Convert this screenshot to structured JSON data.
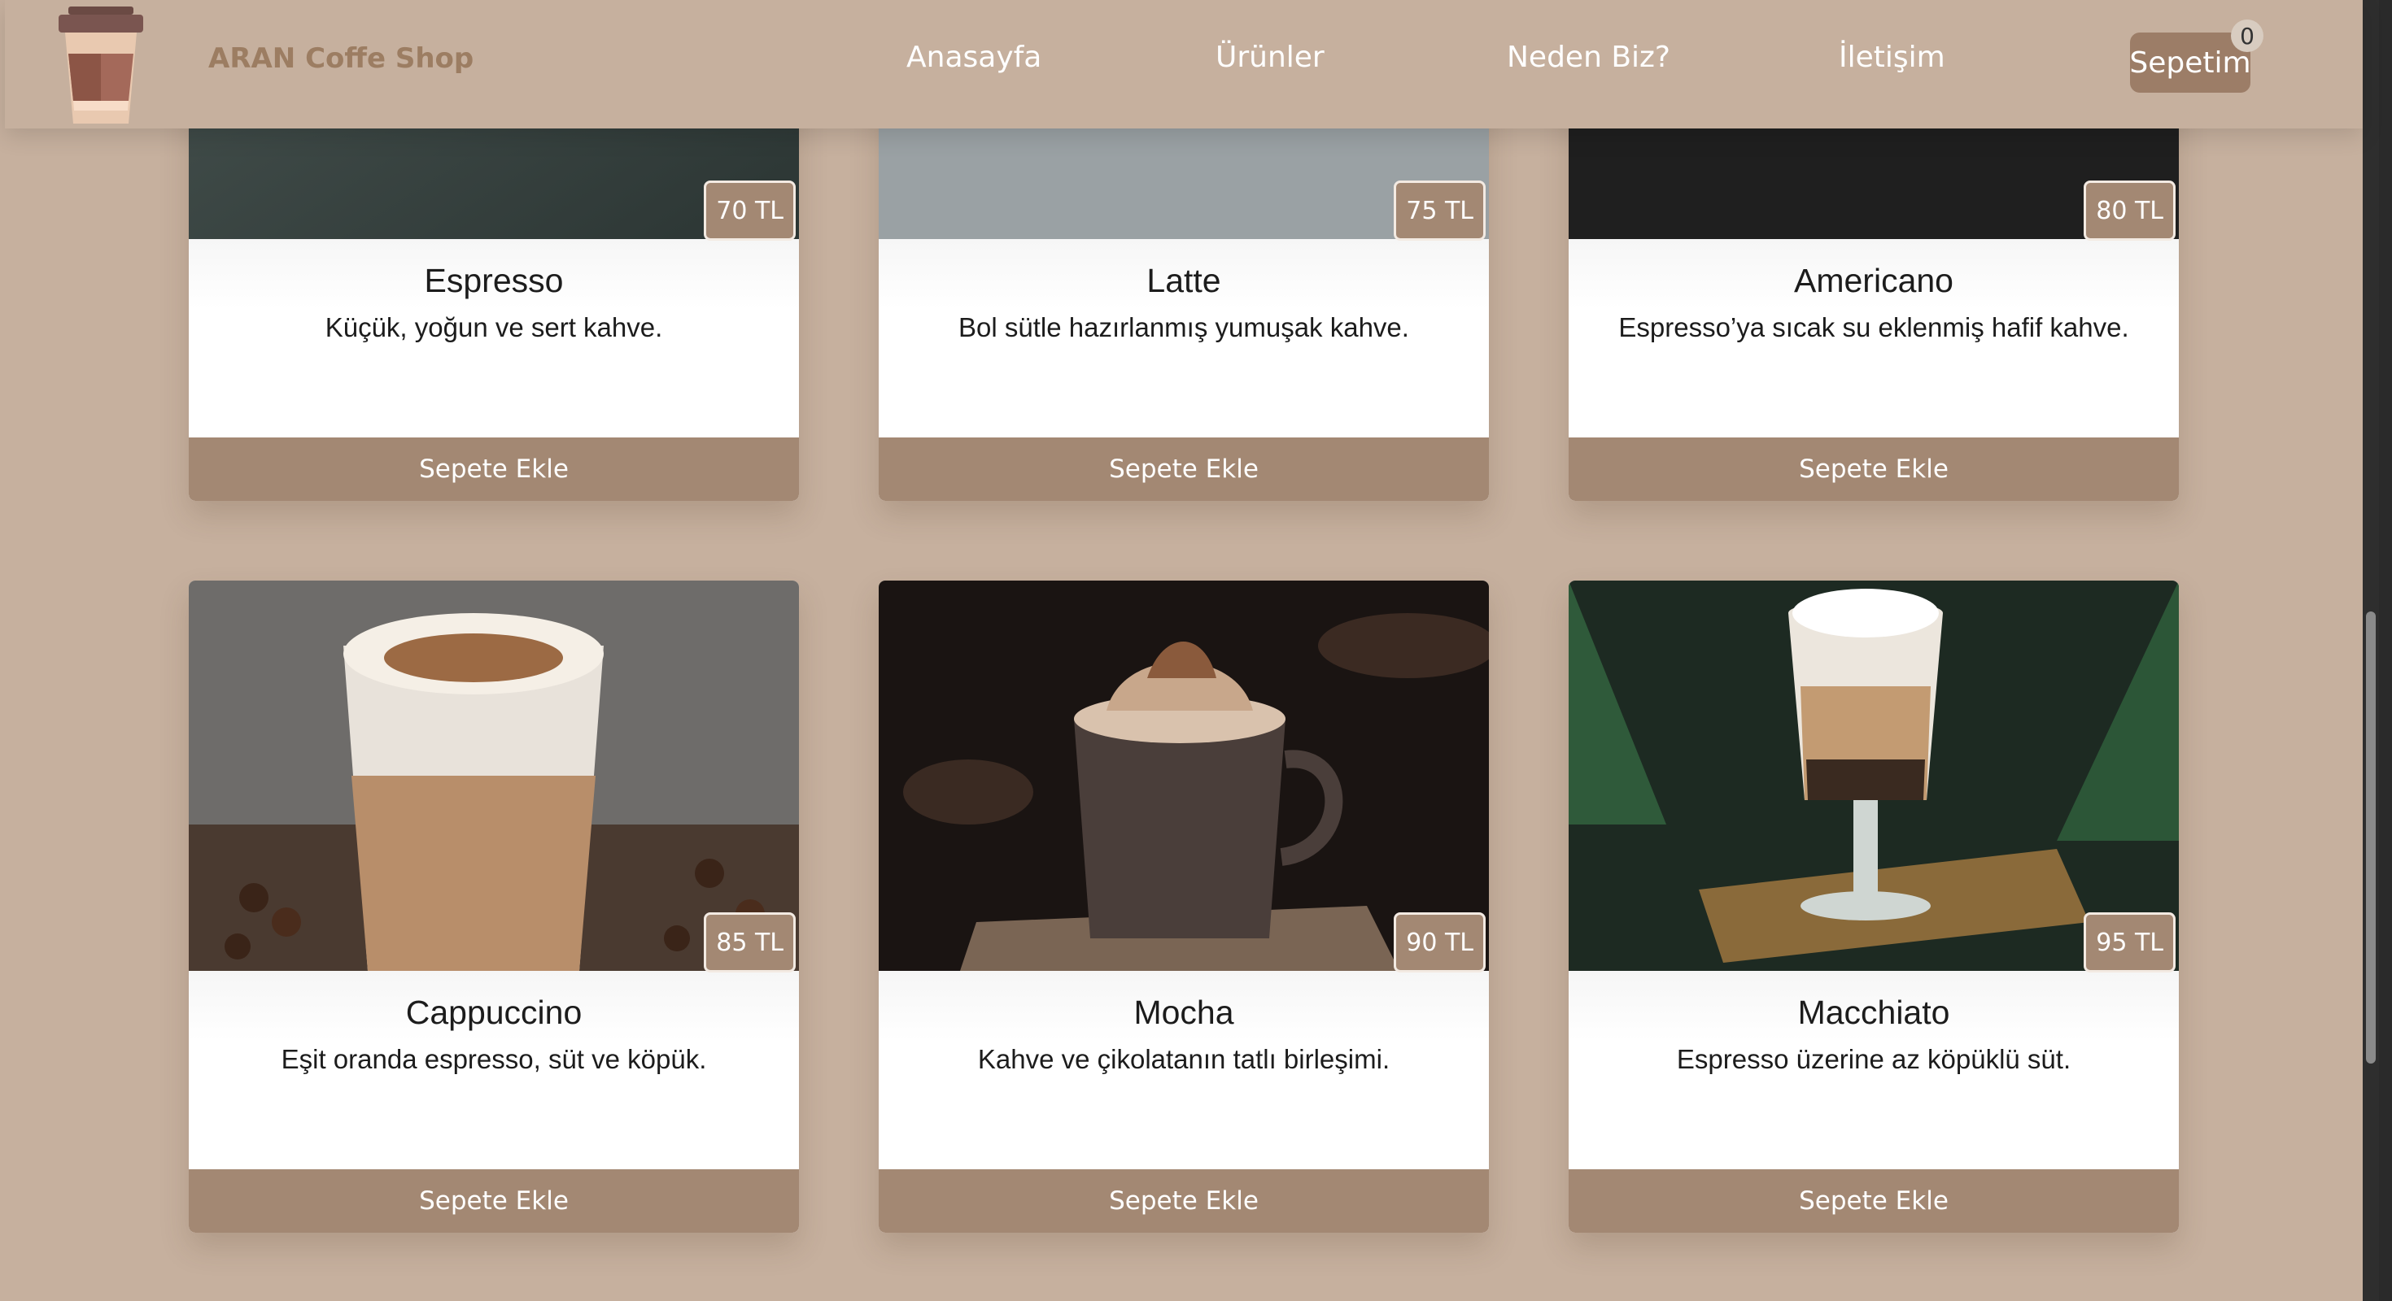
{
  "brand": "ARAN Coffe Shop",
  "nav": [
    "Anasayfa",
    "Ürünler",
    "Neden Biz?",
    "İletişim"
  ],
  "cart": {
    "label": "Sepetim",
    "count": "0"
  },
  "add_label": "Sepete Ekle",
  "products": [
    {
      "name": "Espresso",
      "desc": "Küçük, yoğun ve sert kahve.",
      "price": "70 TL"
    },
    {
      "name": "Latte",
      "desc": "Bol sütle hazırlanmış yumuşak kahve.",
      "price": "75 TL"
    },
    {
      "name": "Americano",
      "desc": "Espresso’ya sıcak su eklenmiş hafif kahve.",
      "price": "80 TL"
    },
    {
      "name": "Cappuccino",
      "desc": "Eşit oranda espresso, süt ve köpük.",
      "price": "85 TL"
    },
    {
      "name": "Mocha",
      "desc": "Kahve ve çikolatanın tatlı birleşimi.",
      "price": "90 TL"
    },
    {
      "name": "Macchiato",
      "desc": "Espresso üzerine az köpüklü süt.",
      "price": "95 TL"
    }
  ],
  "colors": {
    "page_bg": "#c6b09e",
    "accent": "#a38873",
    "brand_text": "#9c7d62"
  }
}
